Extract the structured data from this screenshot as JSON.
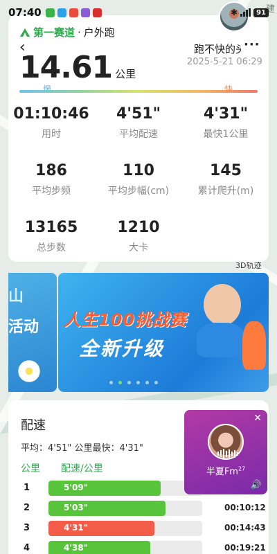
{
  "status_bar": {
    "time": "07:40",
    "battery": "91"
  },
  "header": {
    "brand": "第一赛道",
    "separator": "·",
    "run_type": "户外跑",
    "distance_value": "14.61",
    "distance_unit": "公里",
    "user_name": "跑不快的头",
    "date": "2025-5-21 06:29",
    "more": "···",
    "back": "‹"
  },
  "pace_legend": {
    "slow": "慢",
    "fast": "快"
  },
  "metrics": [
    {
      "value": "01:10:46",
      "label": "用时"
    },
    {
      "value": "4'51\"",
      "label": "平均配速"
    },
    {
      "value": "4'31\"",
      "label": "最快1公里"
    },
    {
      "value": "186",
      "label": "平均步频"
    },
    {
      "value": "110",
      "label": "平均步幅(cm)"
    },
    {
      "value": "145",
      "label": "累计爬升(m)"
    },
    {
      "value": "13165",
      "label": "总步数"
    },
    {
      "value": "1210",
      "label": "大卡"
    }
  ],
  "map": {
    "track_3d": "3D轨迹",
    "edge_char": "建"
  },
  "banner": {
    "left_partial": "山",
    "left_text": "活动",
    "title": "人生100挑战赛",
    "subtitle": "全新升级",
    "dot_count": 6,
    "active_dot": 1
  },
  "pace": {
    "title": "配速",
    "summary": "平均：4'51\"  公里最快：4'31\"",
    "col_km": "公里",
    "col_pace": "配速/公里",
    "rows": [
      {
        "km": "1",
        "pace": "5'09\"",
        "ratio": 0.73,
        "color": "#57c43c",
        "cumulative": ""
      },
      {
        "km": "2",
        "pace": "5'03\"",
        "ratio": 0.76,
        "color": "#57c43c",
        "cumulative": "00:10:12"
      },
      {
        "km": "3",
        "pace": "4'31\"",
        "ratio": 0.69,
        "color": "#f25c48",
        "cumulative": "00:14:43"
      },
      {
        "km": "4",
        "pace": "4'38\"",
        "ratio": 0.66,
        "color": "#57c43c",
        "cumulative": "00:19:21"
      }
    ]
  },
  "music": {
    "name": "半夏Fm",
    "sup": "27",
    "close": "✕",
    "volume": "🔊"
  },
  "colors": {
    "brand_green": "#2fa84f",
    "fast_red": "#f25c48",
    "normal_green": "#57c43c"
  }
}
